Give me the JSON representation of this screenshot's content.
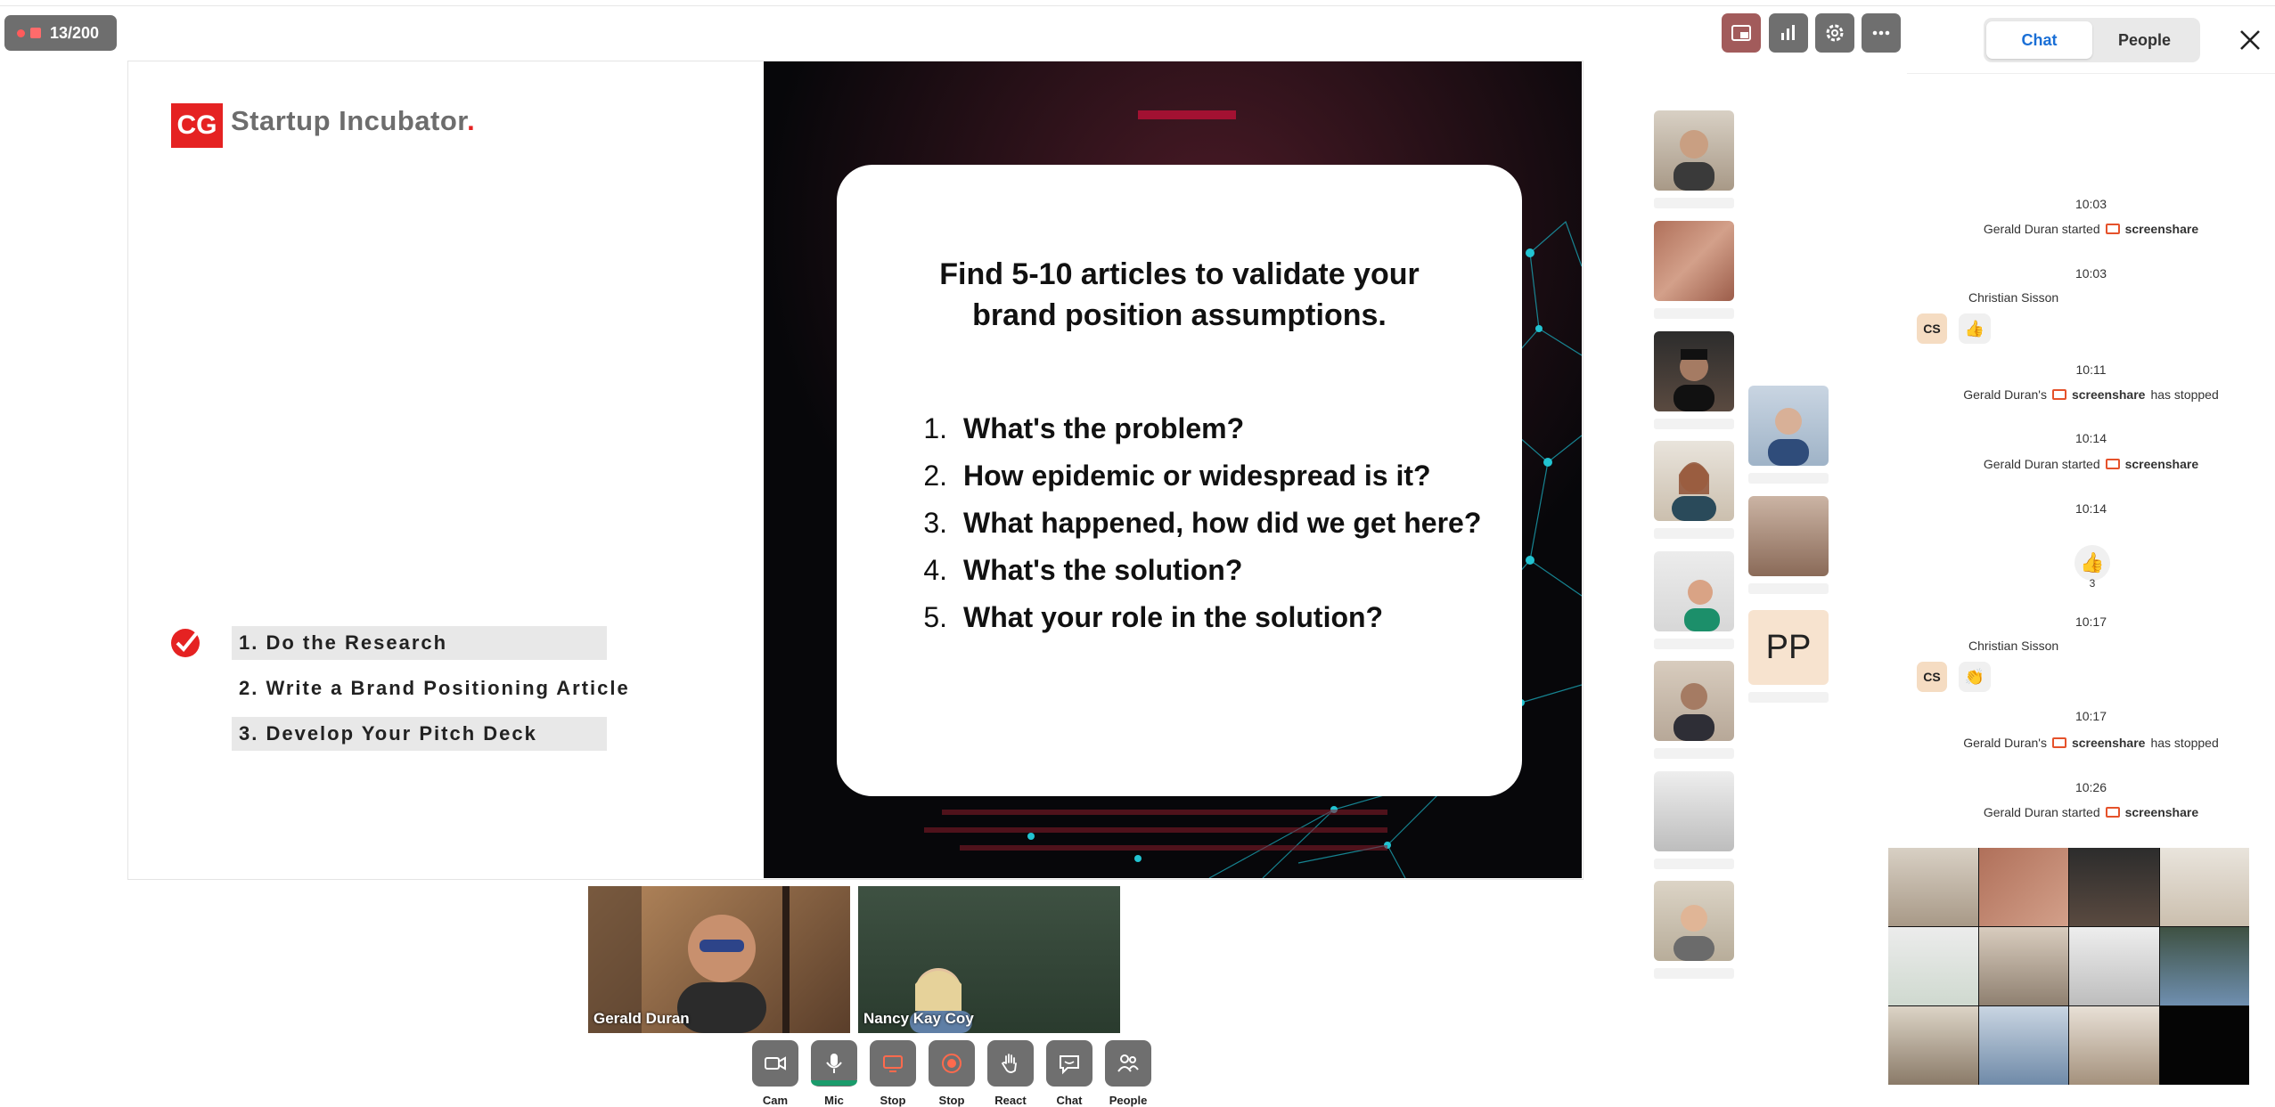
{
  "toolbar": {
    "counter_label": "13/200",
    "icons": [
      "pip-icon",
      "stats-icon",
      "settings-icon",
      "more-icon"
    ]
  },
  "panel_tabs": {
    "chat": "Chat",
    "people": "People"
  },
  "slide": {
    "logo_letters": "CG",
    "brand_name": "Startup Incubator",
    "brand_dot": ".",
    "steps": [
      "1. Do the Research",
      "2. Write a Brand Positioning Article",
      "3. Develop Your Pitch Deck"
    ],
    "card_title_line1": "Find 5-10 articles to validate your",
    "card_title_line2": "brand position assumptions.",
    "questions": [
      {
        "num": "1.",
        "text": "What's the problem?"
      },
      {
        "num": "2.",
        "text": "How epidemic or widespread is it?"
      },
      {
        "num": "3.",
        "text": "What happened, how did we get here?"
      },
      {
        "num": "4.",
        "text": "What's the solution?"
      },
      {
        "num": "5.",
        "text": "What your role in the solution?"
      }
    ]
  },
  "participants": {
    "pp_initials": "PP"
  },
  "videos": [
    {
      "name": "Gerald Duran"
    },
    {
      "name": "Nancy Kay Coy"
    }
  ],
  "controls": [
    {
      "label": "Cam",
      "icon": "camera-icon"
    },
    {
      "label": "Mic",
      "icon": "mic-icon"
    },
    {
      "label": "Stop",
      "icon": "screenshare-icon"
    },
    {
      "label": "Stop",
      "icon": "record-icon"
    },
    {
      "label": "React",
      "icon": "hand-icon"
    },
    {
      "label": "Chat",
      "icon": "chat-icon"
    },
    {
      "label": "People",
      "icon": "people-icon"
    }
  ],
  "chat": {
    "t1": "10:03",
    "e1_actor": "Gerald Duran started",
    "e1_obj": "screenshare",
    "t2": "10:03",
    "m1_sender": "Christian Sisson",
    "m1_initials": "CS",
    "m1_reaction": "👍",
    "t3": "10:11",
    "e2_actor": "Gerald Duran's",
    "e2_obj": "screenshare",
    "e2_tail": "has stopped",
    "t4": "10:14",
    "e3_actor": "Gerald Duran started",
    "e3_obj": "screenshare",
    "t5": "10:14",
    "big_reaction": "👍",
    "big_reaction_count": "3",
    "t6": "10:17",
    "m2_sender": "Christian Sisson",
    "m2_initials": "CS",
    "m2_reaction": "👏",
    "t7": "10:17",
    "e4_actor": "Gerald Duran's",
    "e4_obj": "screenshare",
    "e4_tail": "has stopped",
    "t8": "10:26",
    "e5_actor": "Gerald Duran started",
    "e5_obj": "screenshare"
  },
  "colors": {
    "brand_red": "#e52222",
    "accent_blue": "#1a6fd6",
    "screenshare_orange": "#e5522b",
    "mic_green": "#1b9b6b"
  }
}
